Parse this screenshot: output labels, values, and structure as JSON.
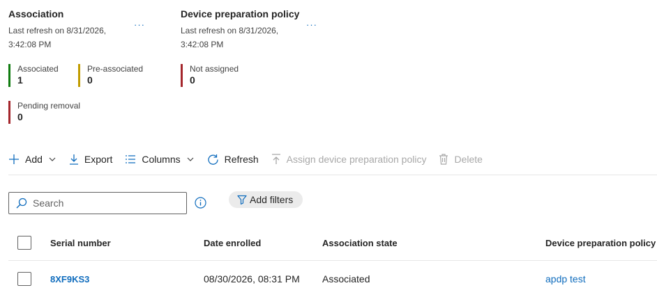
{
  "cards": {
    "association": {
      "title": "Association",
      "refresh_line1": "Last refresh on 8/31/2026,",
      "refresh_line2": "3:42:08 PM",
      "more": "···",
      "stats": [
        {
          "label": "Associated",
          "value": "1",
          "color": "#107c10"
        },
        {
          "label": "Pre-associated",
          "value": "0",
          "color": "#c19c00"
        },
        {
          "label": "Pending removal",
          "value": "0",
          "color": "#a4262c"
        }
      ]
    },
    "policy": {
      "title": "Device preparation policy",
      "refresh_line1": "Last refresh on 8/31/2026,",
      "refresh_line2": "3:42:08 PM",
      "more": "···",
      "stats": [
        {
          "label": "Not assigned",
          "value": "0",
          "color": "#a4262c"
        }
      ]
    }
  },
  "toolbar": {
    "add_label": "Add",
    "export_label": "Export",
    "columns_label": "Columns",
    "refresh_label": "Refresh",
    "assign_label": "Assign device preparation policy",
    "delete_label": "Delete"
  },
  "search": {
    "placeholder": "Search"
  },
  "filters": {
    "add_label": "Add filters"
  },
  "table": {
    "columns": [
      "Serial number",
      "Date enrolled",
      "Association state",
      "Device preparation policy"
    ],
    "rows": [
      {
        "serial": "8XF9KS3",
        "date": "08/30/2026, 08:31 PM",
        "state": "Associated",
        "policy": "apdp test"
      }
    ]
  },
  "colors": {
    "accent": "#0f6cbd",
    "disabled": "#a8a8a8"
  }
}
